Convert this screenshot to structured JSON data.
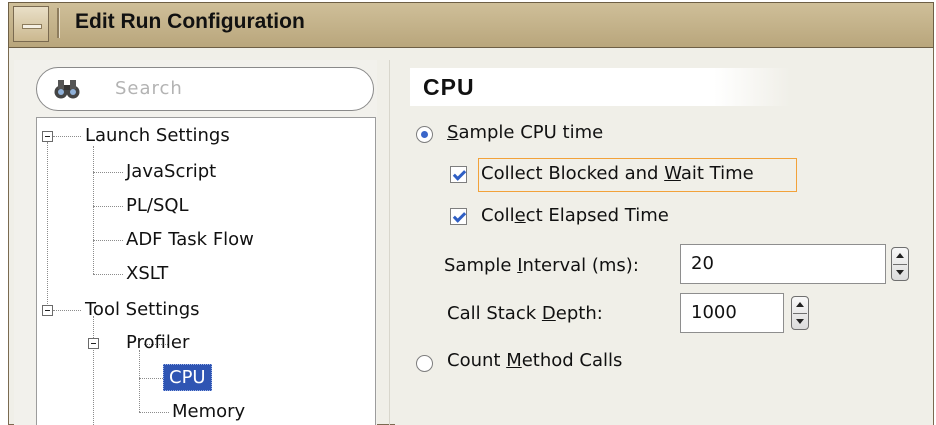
{
  "window": {
    "title": "Edit Run Configuration"
  },
  "search": {
    "placeholder": "Search"
  },
  "tree": {
    "launch_settings": "Launch Settings",
    "javascript": "JavaScript",
    "plsql": "PL/SQL",
    "adf_task_flow": "ADF Task Flow",
    "xslt": "XSLT",
    "tool_settings": "Tool Settings",
    "profiler": "Profiler",
    "cpu": "CPU",
    "memory": "Memory"
  },
  "panel": {
    "header": "CPU",
    "sample_cpu_time": {
      "pre": "",
      "key": "S",
      "post": "ample CPU time"
    },
    "collect_blocked": {
      "pre": "Collect Blocked and ",
      "key": "W",
      "post": "ait Time"
    },
    "collect_elapsed": {
      "pre": "Coll",
      "key": "e",
      "post": "ct Elapsed Time"
    },
    "sample_interval_label": {
      "pre": "Sample ",
      "key": "I",
      "post": "nterval (ms):"
    },
    "sample_interval_value": "20",
    "call_stack_label": {
      "pre": "Call Stack ",
      "key": "D",
      "post": "epth:"
    },
    "call_stack_value": "1000",
    "count_method_calls": {
      "pre": "Count ",
      "key": "M",
      "post": "ethod Calls"
    }
  },
  "state": {
    "sample_cpu_time_selected": true,
    "collect_blocked_checked": true,
    "collect_elapsed_checked": true,
    "count_method_calls_selected": false
  },
  "colors": {
    "selection": "#2f55b3",
    "focus_border": "#f2a23a",
    "titlebar": "#c4b189"
  }
}
